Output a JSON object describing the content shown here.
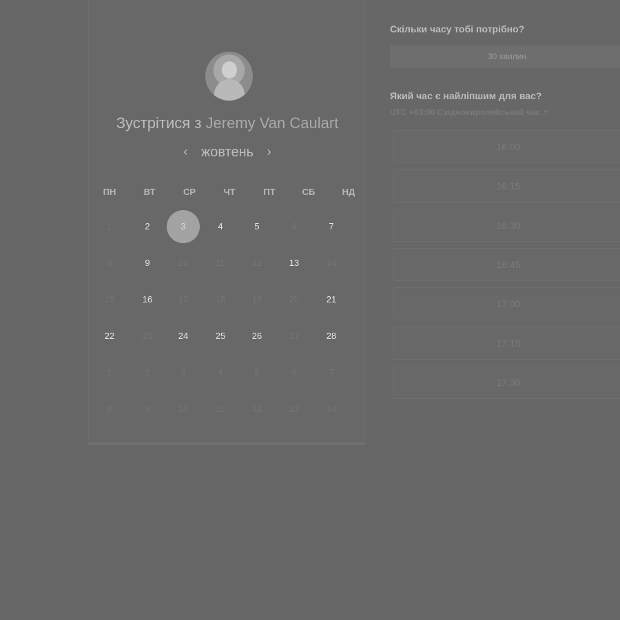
{
  "booking": {
    "title_prefix": "Зустрітися з",
    "host_name": "Jeremy Van Caulart",
    "month": "жовтень",
    "prev_arrow": "‹",
    "next_arrow": "›",
    "weekdays": [
      "ПН",
      "ВТ",
      "СР",
      "ЧТ",
      "ПТ",
      "СБ",
      "НД"
    ],
    "weeks": [
      [
        {
          "d": "1",
          "s": "dim"
        },
        {
          "d": "2",
          "s": "avail"
        },
        {
          "d": "3",
          "s": "selected"
        },
        {
          "d": "4",
          "s": "avail"
        },
        {
          "d": "5",
          "s": "avail"
        },
        {
          "d": "6",
          "s": "dim"
        },
        {
          "d": "7",
          "s": "avail"
        }
      ],
      [
        {
          "d": "8",
          "s": "dim"
        },
        {
          "d": "9",
          "s": "avail"
        },
        {
          "d": "10",
          "s": "dim"
        },
        {
          "d": "11",
          "s": "dim"
        },
        {
          "d": "12",
          "s": "dim"
        },
        {
          "d": "13",
          "s": "avail"
        },
        {
          "d": "14",
          "s": "dim"
        }
      ],
      [
        {
          "d": "15",
          "s": "dim"
        },
        {
          "d": "16",
          "s": "avail"
        },
        {
          "d": "17",
          "s": "dim"
        },
        {
          "d": "18",
          "s": "dim"
        },
        {
          "d": "19",
          "s": "dim"
        },
        {
          "d": "20",
          "s": "dim"
        },
        {
          "d": "21",
          "s": "avail"
        }
      ],
      [
        {
          "d": "22",
          "s": "avail"
        },
        {
          "d": "23",
          "s": "dim"
        },
        {
          "d": "24",
          "s": "avail"
        },
        {
          "d": "25",
          "s": "avail"
        },
        {
          "d": "26",
          "s": "avail"
        },
        {
          "d": "27",
          "s": "dim"
        },
        {
          "d": "28",
          "s": "avail"
        }
      ],
      [
        {
          "d": "1",
          "s": "dim"
        },
        {
          "d": "2",
          "s": "dim"
        },
        {
          "d": "3",
          "s": "dim"
        },
        {
          "d": "4",
          "s": "dim"
        },
        {
          "d": "5",
          "s": "dim"
        },
        {
          "d": "6",
          "s": "dim"
        },
        {
          "d": "7",
          "s": "dim"
        }
      ],
      [
        {
          "d": "8",
          "s": "dim"
        },
        {
          "d": "9",
          "s": "dim"
        },
        {
          "d": "10",
          "s": "dim"
        },
        {
          "d": "11",
          "s": "dim"
        },
        {
          "d": "12",
          "s": "dim"
        },
        {
          "d": "13",
          "s": "dim"
        },
        {
          "d": "14",
          "s": "dim"
        }
      ]
    ]
  },
  "side": {
    "duration_question": "Скільки часу тобі потрібно?",
    "duration_value": "30 хвилин",
    "time_question": "Який час є найліпшим для вас?",
    "timezone": "UTC +03:00 Східноєвропейський час",
    "timezone_caret": "▼",
    "slots": [
      "16:00",
      "16:15",
      "16:30",
      "16:45",
      "17:00",
      "17:15",
      "17:30"
    ]
  },
  "colors": {
    "overlay": "#676767",
    "selected_day": "#a3a3a3"
  }
}
